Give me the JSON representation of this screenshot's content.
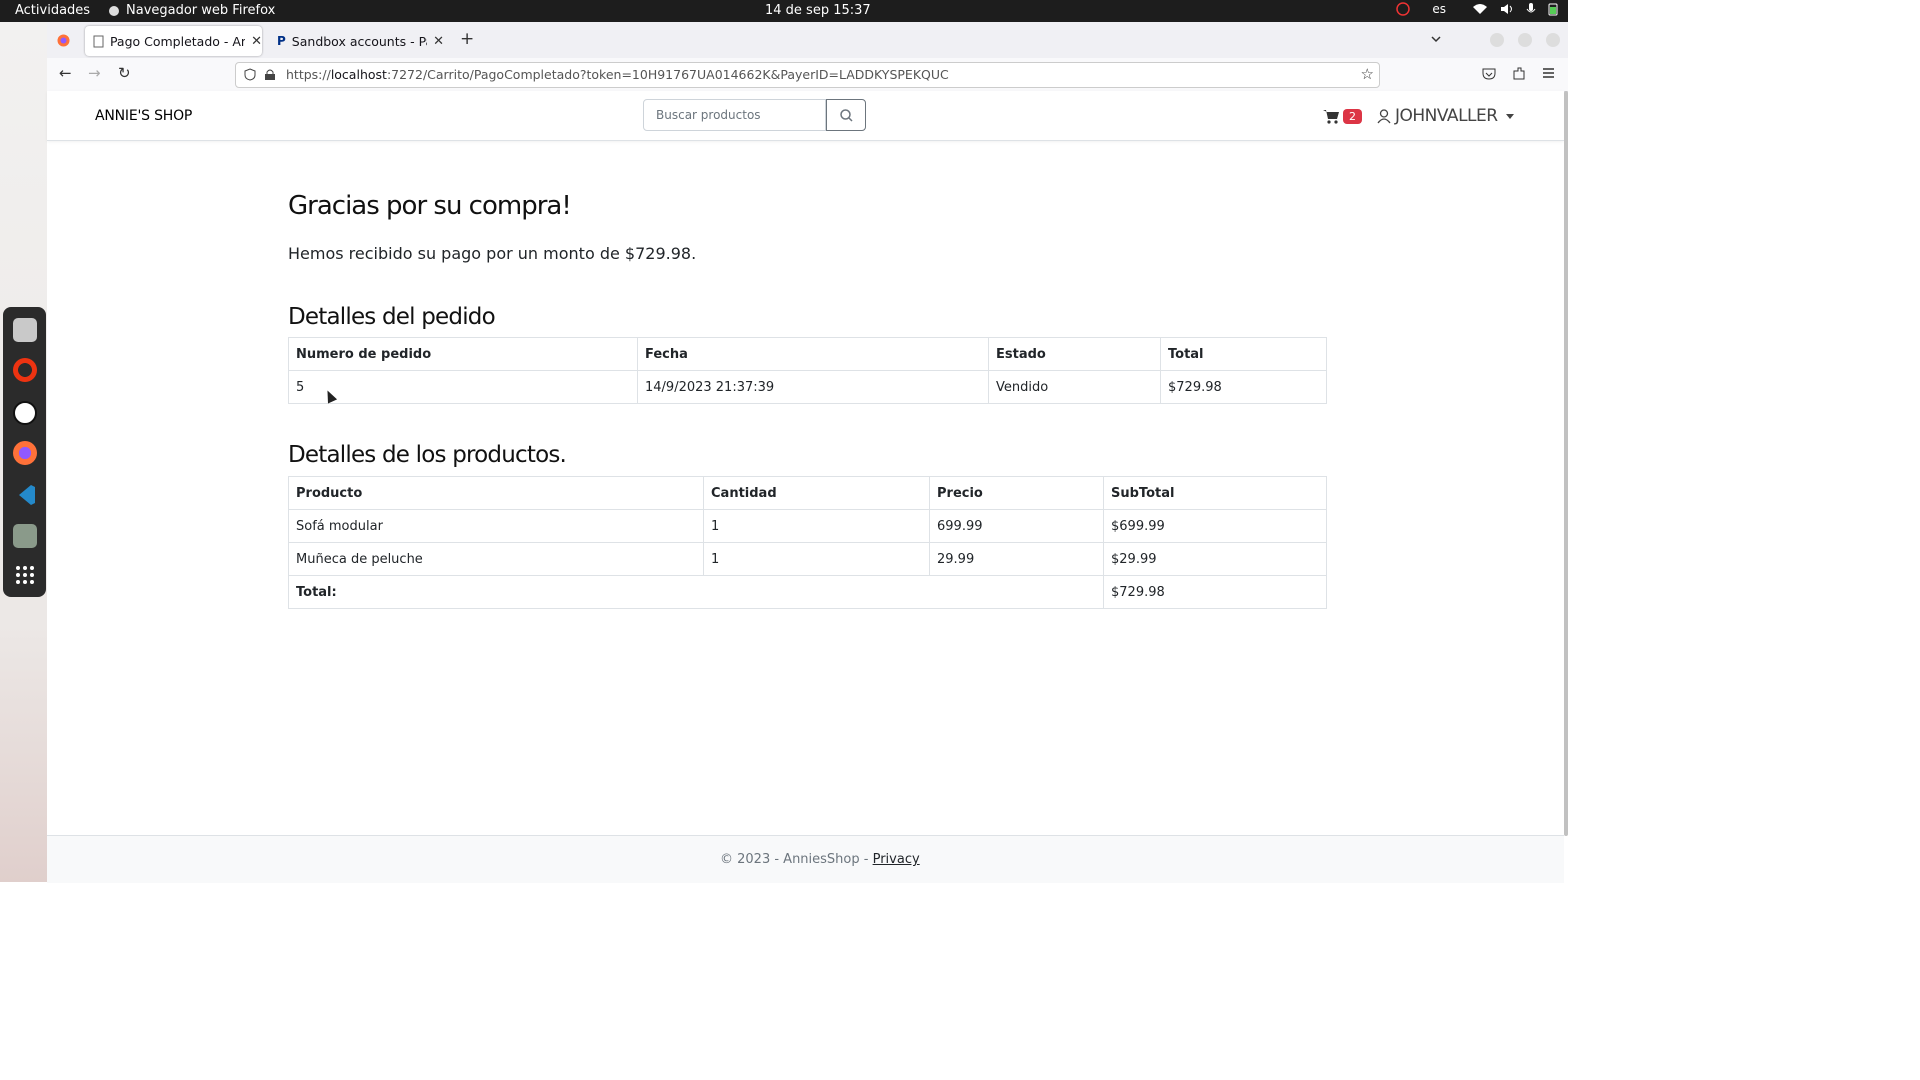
{
  "system": {
    "activities": "Actividades",
    "app_name": "Navegador web Firefox",
    "datetime": "14 de sep  15:37",
    "lang": "es"
  },
  "browser": {
    "tabs": [
      {
        "title": "Pago Completado - Annie",
        "active": true
      },
      {
        "title": "Sandbox accounts - PayP",
        "active": false
      }
    ],
    "url_prefix": "https://",
    "url_host": "localhost",
    "url_rest": ":7272/Carrito/PagoCompletado?token=10H91767UA014662K&PayerID=LADDKYSPEKQUC"
  },
  "site": {
    "brand": "ANNIE'S SHOP",
    "search_placeholder": "Buscar productos",
    "cart_count": "2",
    "username": "JOHNVALLER"
  },
  "main": {
    "title": "Gracias por su compra!",
    "message": "Hemos recibido su pago por un monto de $729.98.",
    "order_heading": "Detalles del pedido",
    "order_headers": [
      "Numero de pedido",
      "Fecha",
      "Estado",
      "Total"
    ],
    "order_row": [
      "5",
      "14/9/2023 21:37:39",
      "Vendido",
      "$729.98"
    ],
    "products_heading": "Detalles de los productos.",
    "product_headers": [
      "Producto",
      "Cantidad",
      "Precio",
      "SubTotal"
    ],
    "products": [
      [
        "Sofá modular",
        "1",
        "699.99",
        "$699.99"
      ],
      [
        "Muñeca de peluche",
        "1",
        "29.99",
        "$29.99"
      ]
    ],
    "total_label": "Total:",
    "total_value": "$729.98"
  },
  "footer": {
    "text": "© 2023 - AnniesShop - ",
    "link": "Privacy"
  },
  "colors": {
    "badge": "#dc3545",
    "topbar": "#1d1d1d",
    "dock": "#2b2b2b"
  }
}
